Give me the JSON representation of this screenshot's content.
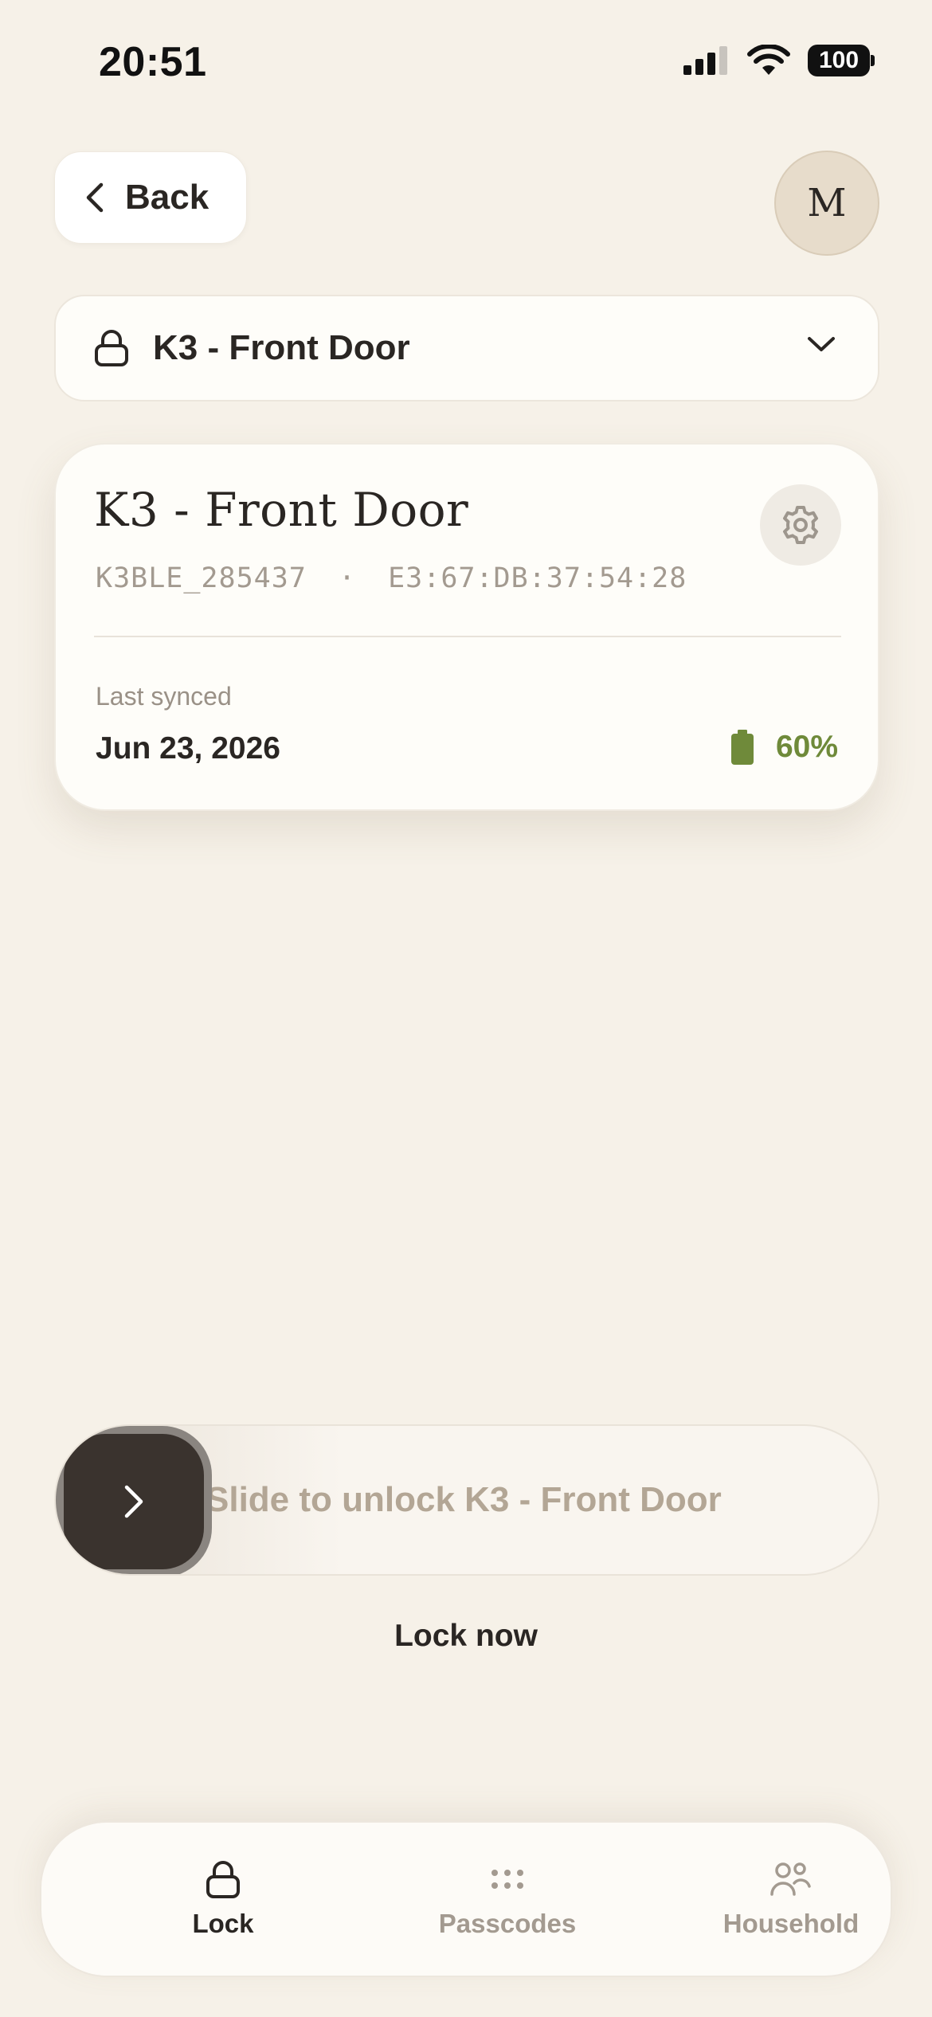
{
  "status_bar": {
    "time": "20:51",
    "battery": "100"
  },
  "header": {
    "back_label": "Back",
    "avatar_initial": "M"
  },
  "lock_selector": {
    "selected": "K3 - Front Door"
  },
  "lock_card": {
    "title": "K3 - Front Door",
    "device_id": "K3BLE_285437",
    "separator": "·",
    "mac_address": "E3:67:DB:37:54:28",
    "last_synced_label": "Last synced",
    "last_synced_value": "Jun 23, 2026",
    "battery_percent": "60%",
    "battery_color": "#6f8a3a"
  },
  "slider": {
    "label": "Slide to unlock K3 - Front Door"
  },
  "lock_now": "Lock now",
  "bottom_nav": {
    "items": [
      {
        "label": "Lock",
        "icon": "lock-icon",
        "active": true
      },
      {
        "label": "Passcodes",
        "icon": "keypad-dots-icon",
        "active": false
      },
      {
        "label": "Household",
        "icon": "people-icon",
        "active": false
      }
    ]
  }
}
